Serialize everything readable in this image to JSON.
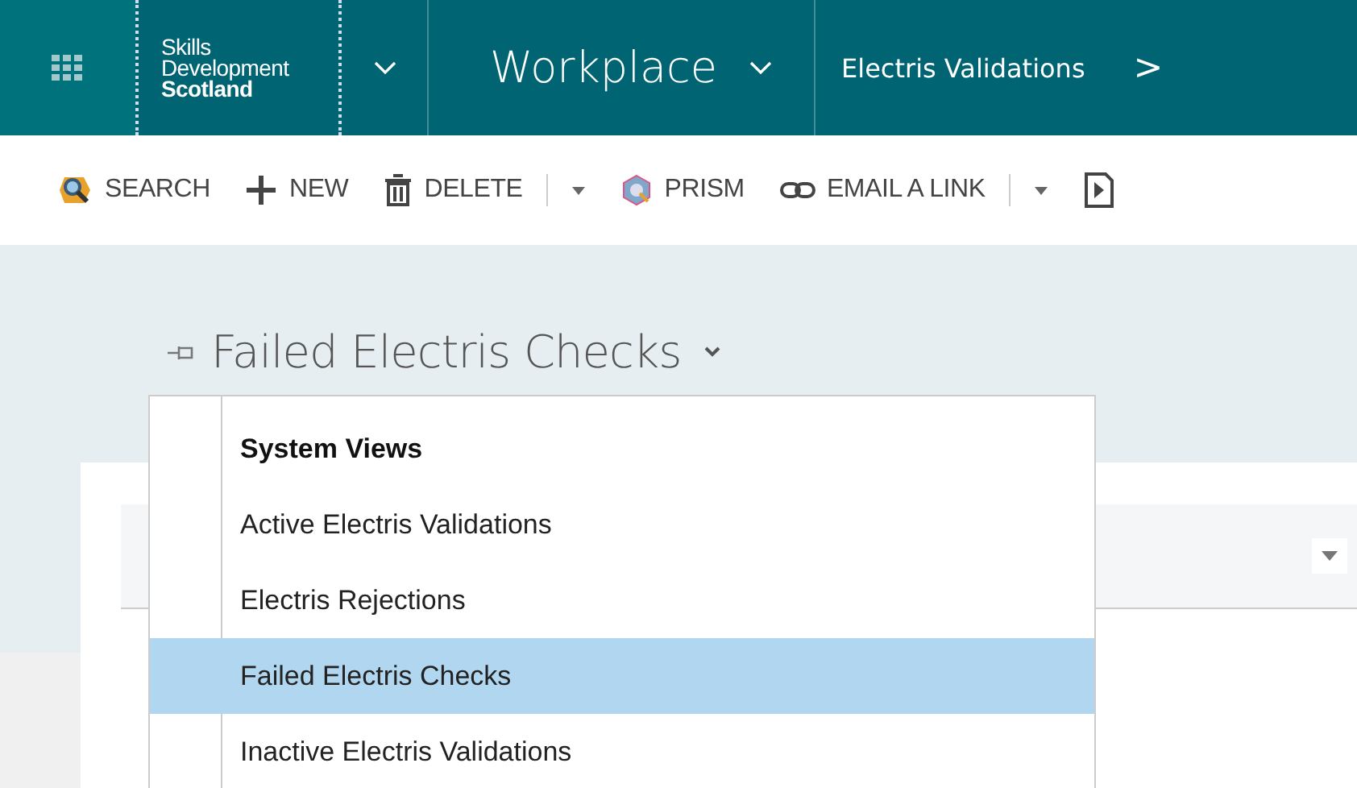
{
  "nav": {
    "logo_lines": [
      "Skills",
      "Development",
      "Scotland"
    ],
    "app_name": "Workplace",
    "entity": "Electris Validations",
    "breadcrumb_arrow": ">"
  },
  "commands": [
    {
      "label": "SEARCH",
      "split": false
    },
    {
      "label": "NEW",
      "split": false
    },
    {
      "label": "DELETE",
      "split": true
    },
    {
      "label": "PRISM",
      "split": false
    },
    {
      "label": "EMAIL A LINK",
      "split": true
    }
  ],
  "view": {
    "title": "Failed Electris Checks"
  },
  "view_menu": {
    "header": "System Views",
    "items": [
      {
        "label": "Active Electris Validations",
        "selected": false
      },
      {
        "label": "Electris Rejections",
        "selected": false
      },
      {
        "label": "Failed Electris Checks",
        "selected": true
      },
      {
        "label": "Inactive Electris Validations",
        "selected": false
      }
    ]
  }
}
